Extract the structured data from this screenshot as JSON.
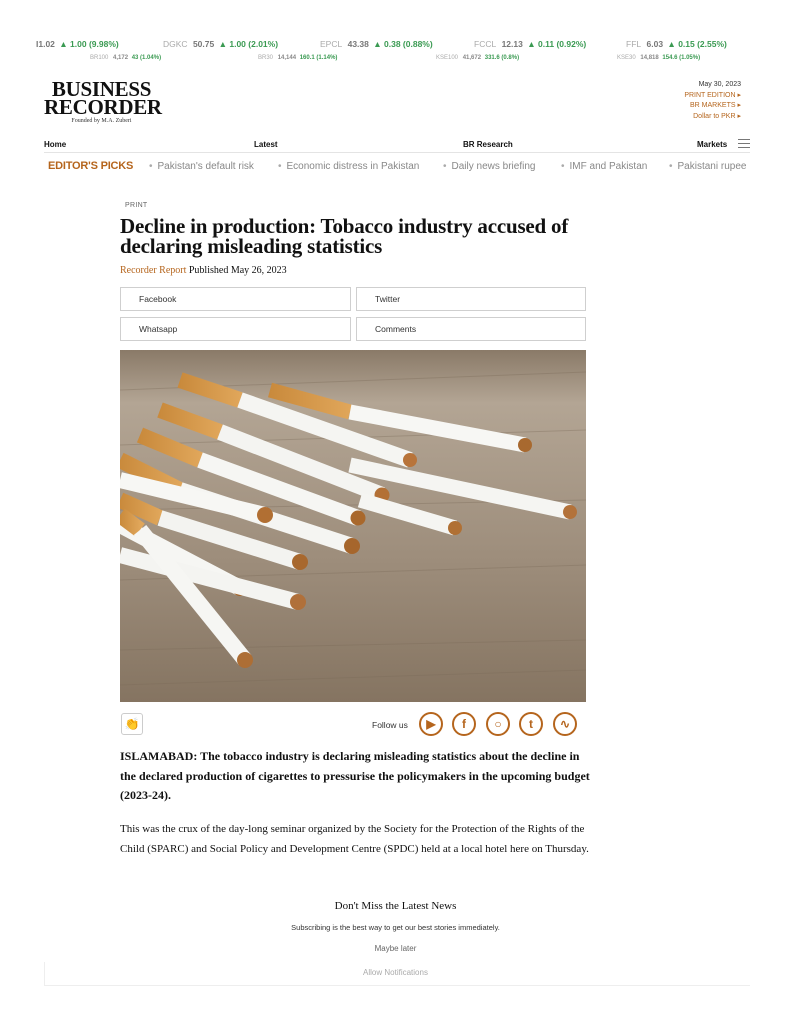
{
  "ticker": {
    "row1": [
      {
        "sym": "",
        "price": "I1.02",
        "change": "▲ 1.00 (9.98%)"
      },
      {
        "sym": "DGKC",
        "price": "50.75",
        "change": "▲ 1.00 (2.01%)"
      },
      {
        "sym": "EPCL",
        "price": "43.38",
        "change": "▲ 0.38 (0.88%)"
      },
      {
        "sym": "FCCL",
        "price": "12.13",
        "change": "▲ 0.11 (0.92%)"
      },
      {
        "sym": "FFL",
        "price": "6.03",
        "change": "▲ 0.15 (2.55%)"
      }
    ],
    "row2": [
      {
        "sym": "BR100",
        "price": "4,172",
        "change": "43 (1.04%)"
      },
      {
        "sym": "BR30",
        "price": "14,144",
        "change": "160.1 (1.14%)"
      },
      {
        "sym": "KSE100",
        "price": "41,672",
        "change": "331.6 (0.8%)"
      },
      {
        "sym": "KSE30",
        "price": "14,818",
        "change": "154.6 (1.05%)"
      }
    ]
  },
  "logo": {
    "line1": "BUSINESS",
    "line2": "RECORDER",
    "tagline": "Founded by M.A. Zuberi"
  },
  "header": {
    "date": "May 30, 2023",
    "links": [
      "PRINT EDITION",
      "BR MARKETS",
      "Dollar to PKR"
    ]
  },
  "nav": {
    "items": [
      "Home",
      "Latest",
      "BR Research",
      "Markets"
    ]
  },
  "picks": {
    "heading": "EDITOR'S PICKS",
    "items": [
      "Pakistan's default risk",
      "Economic distress in Pakistan",
      "Daily news briefing",
      "IMF and Pakistan",
      "Pakistani rupee"
    ]
  },
  "article": {
    "section": "PRINT",
    "title": "Decline in production: Tobacco industry accused of declaring misleading statistics",
    "author": "Recorder Report",
    "published": "Published May 26, 2023",
    "share": [
      "Facebook",
      "Twitter",
      "Whatsapp",
      "Comments"
    ],
    "follow_label": "Follow us",
    "social_icons": [
      "youtube-icon",
      "facebook-icon",
      "instagram-icon",
      "twitter-icon",
      "rss-icon"
    ],
    "lead": "ISLAMABAD: The tobacco industry is declaring misleading statistics about the decline in the declared production of cigarettes to pressurise the policymakers in the upcoming budget (2023-24).",
    "paragraph": "This was the crux of the day-long seminar organized by the Society for the Protection of the Rights of the Child (SPARC) and Social Policy and Development Centre (SPDC) held at a local hotel here on Thursday."
  },
  "subscribe": {
    "title": "Don't Miss the Latest News",
    "subtitle": "Subscribing is the best way to get our best stories immediately.",
    "maybe": "Maybe later",
    "allow": "Allow Notifications"
  },
  "colors": {
    "accent": "#b5651d",
    "up": "#3a9a52"
  }
}
